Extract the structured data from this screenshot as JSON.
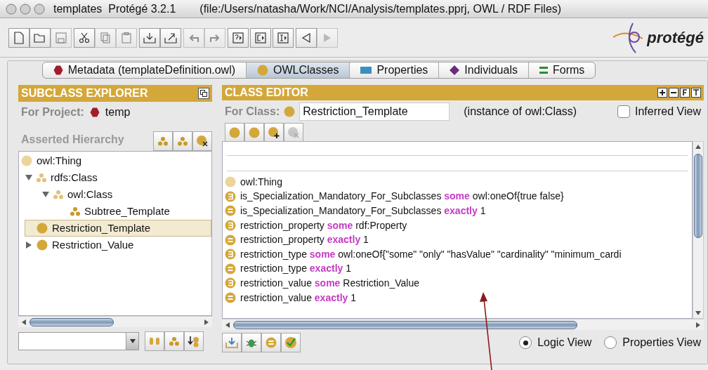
{
  "window": {
    "title": "templates  Protégé 3.2.1",
    "file": "(file:/Users/natasha/Work/NCI/Analysis/templates.pprj, OWL / RDF Files)"
  },
  "logo": {
    "text": "protégé"
  },
  "tabs": [
    {
      "label": "Metadata (templateDefinition.owl)",
      "kind": "metadata",
      "selected": false
    },
    {
      "label": "OWLClasses",
      "kind": "classes",
      "selected": true
    },
    {
      "label": "Properties",
      "kind": "properties",
      "selected": false
    },
    {
      "label": "Individuals",
      "kind": "individuals",
      "selected": false
    },
    {
      "label": "Forms",
      "kind": "forms",
      "selected": false
    }
  ],
  "subclass_explorer": {
    "title": "SUBCLASS EXPLORER",
    "project_label": "For Project:",
    "project": "temp",
    "hierarchy_label": "Asserted Hierarchy",
    "tree": [
      {
        "label": "owl:Thing",
        "kind": "thing",
        "selected": false,
        "children": [
          {
            "label": "rdfs:Class",
            "kind": "metaclass",
            "expanded": true,
            "selected": false,
            "children": [
              {
                "label": "owl:Class",
                "kind": "metaclass",
                "expanded": true,
                "selected": false,
                "children": [
                  {
                    "label": "Subtree_Template",
                    "kind": "metaclass-solid",
                    "selected": false
                  }
                ]
              }
            ]
          },
          {
            "label": "Restriction_Template",
            "kind": "class",
            "selected": true
          },
          {
            "label": "Restriction_Value",
            "kind": "class",
            "expanded": false,
            "selected": false
          }
        ]
      }
    ]
  },
  "class_editor": {
    "title": "CLASS EDITOR",
    "class_label": "For Class:",
    "class_name": "Restriction_Template",
    "instance_of": "(instance of owl:Class)",
    "inferred_view": {
      "label": "Inferred View",
      "checked": false
    },
    "conditions": [
      {
        "kind": "thing",
        "property": "owl:Thing"
      },
      {
        "kind": "some",
        "property": "is_Specialization_Mandatory_For_Subclasses",
        "keyword": "some",
        "filler": "owl:oneOf{true false}"
      },
      {
        "kind": "exactly",
        "property": "is_Specialization_Mandatory_For_Subclasses",
        "keyword": "exactly",
        "filler": "1"
      },
      {
        "kind": "some",
        "property": "restriction_property",
        "keyword": "some",
        "filler": "rdf:Property"
      },
      {
        "kind": "exactly",
        "property": "restriction_property",
        "keyword": "exactly",
        "filler": "1"
      },
      {
        "kind": "some",
        "property": "restriction_type",
        "keyword": "some",
        "filler": "owl:oneOf{\"some\" \"only\" \"hasValue\" \"cardinality\" \"minimum_cardi"
      },
      {
        "kind": "exactly",
        "property": "restriction_type",
        "keyword": "exactly",
        "filler": "1"
      },
      {
        "kind": "some",
        "property": "restriction_value",
        "keyword": "some",
        "filler": "Restriction_Value"
      },
      {
        "kind": "exactly",
        "property": "restriction_value",
        "keyword": "exactly",
        "filler": "1"
      }
    ]
  },
  "view_options": [
    {
      "label": "Logic View",
      "selected": true
    },
    {
      "label": "Properties View",
      "selected": false
    }
  ]
}
